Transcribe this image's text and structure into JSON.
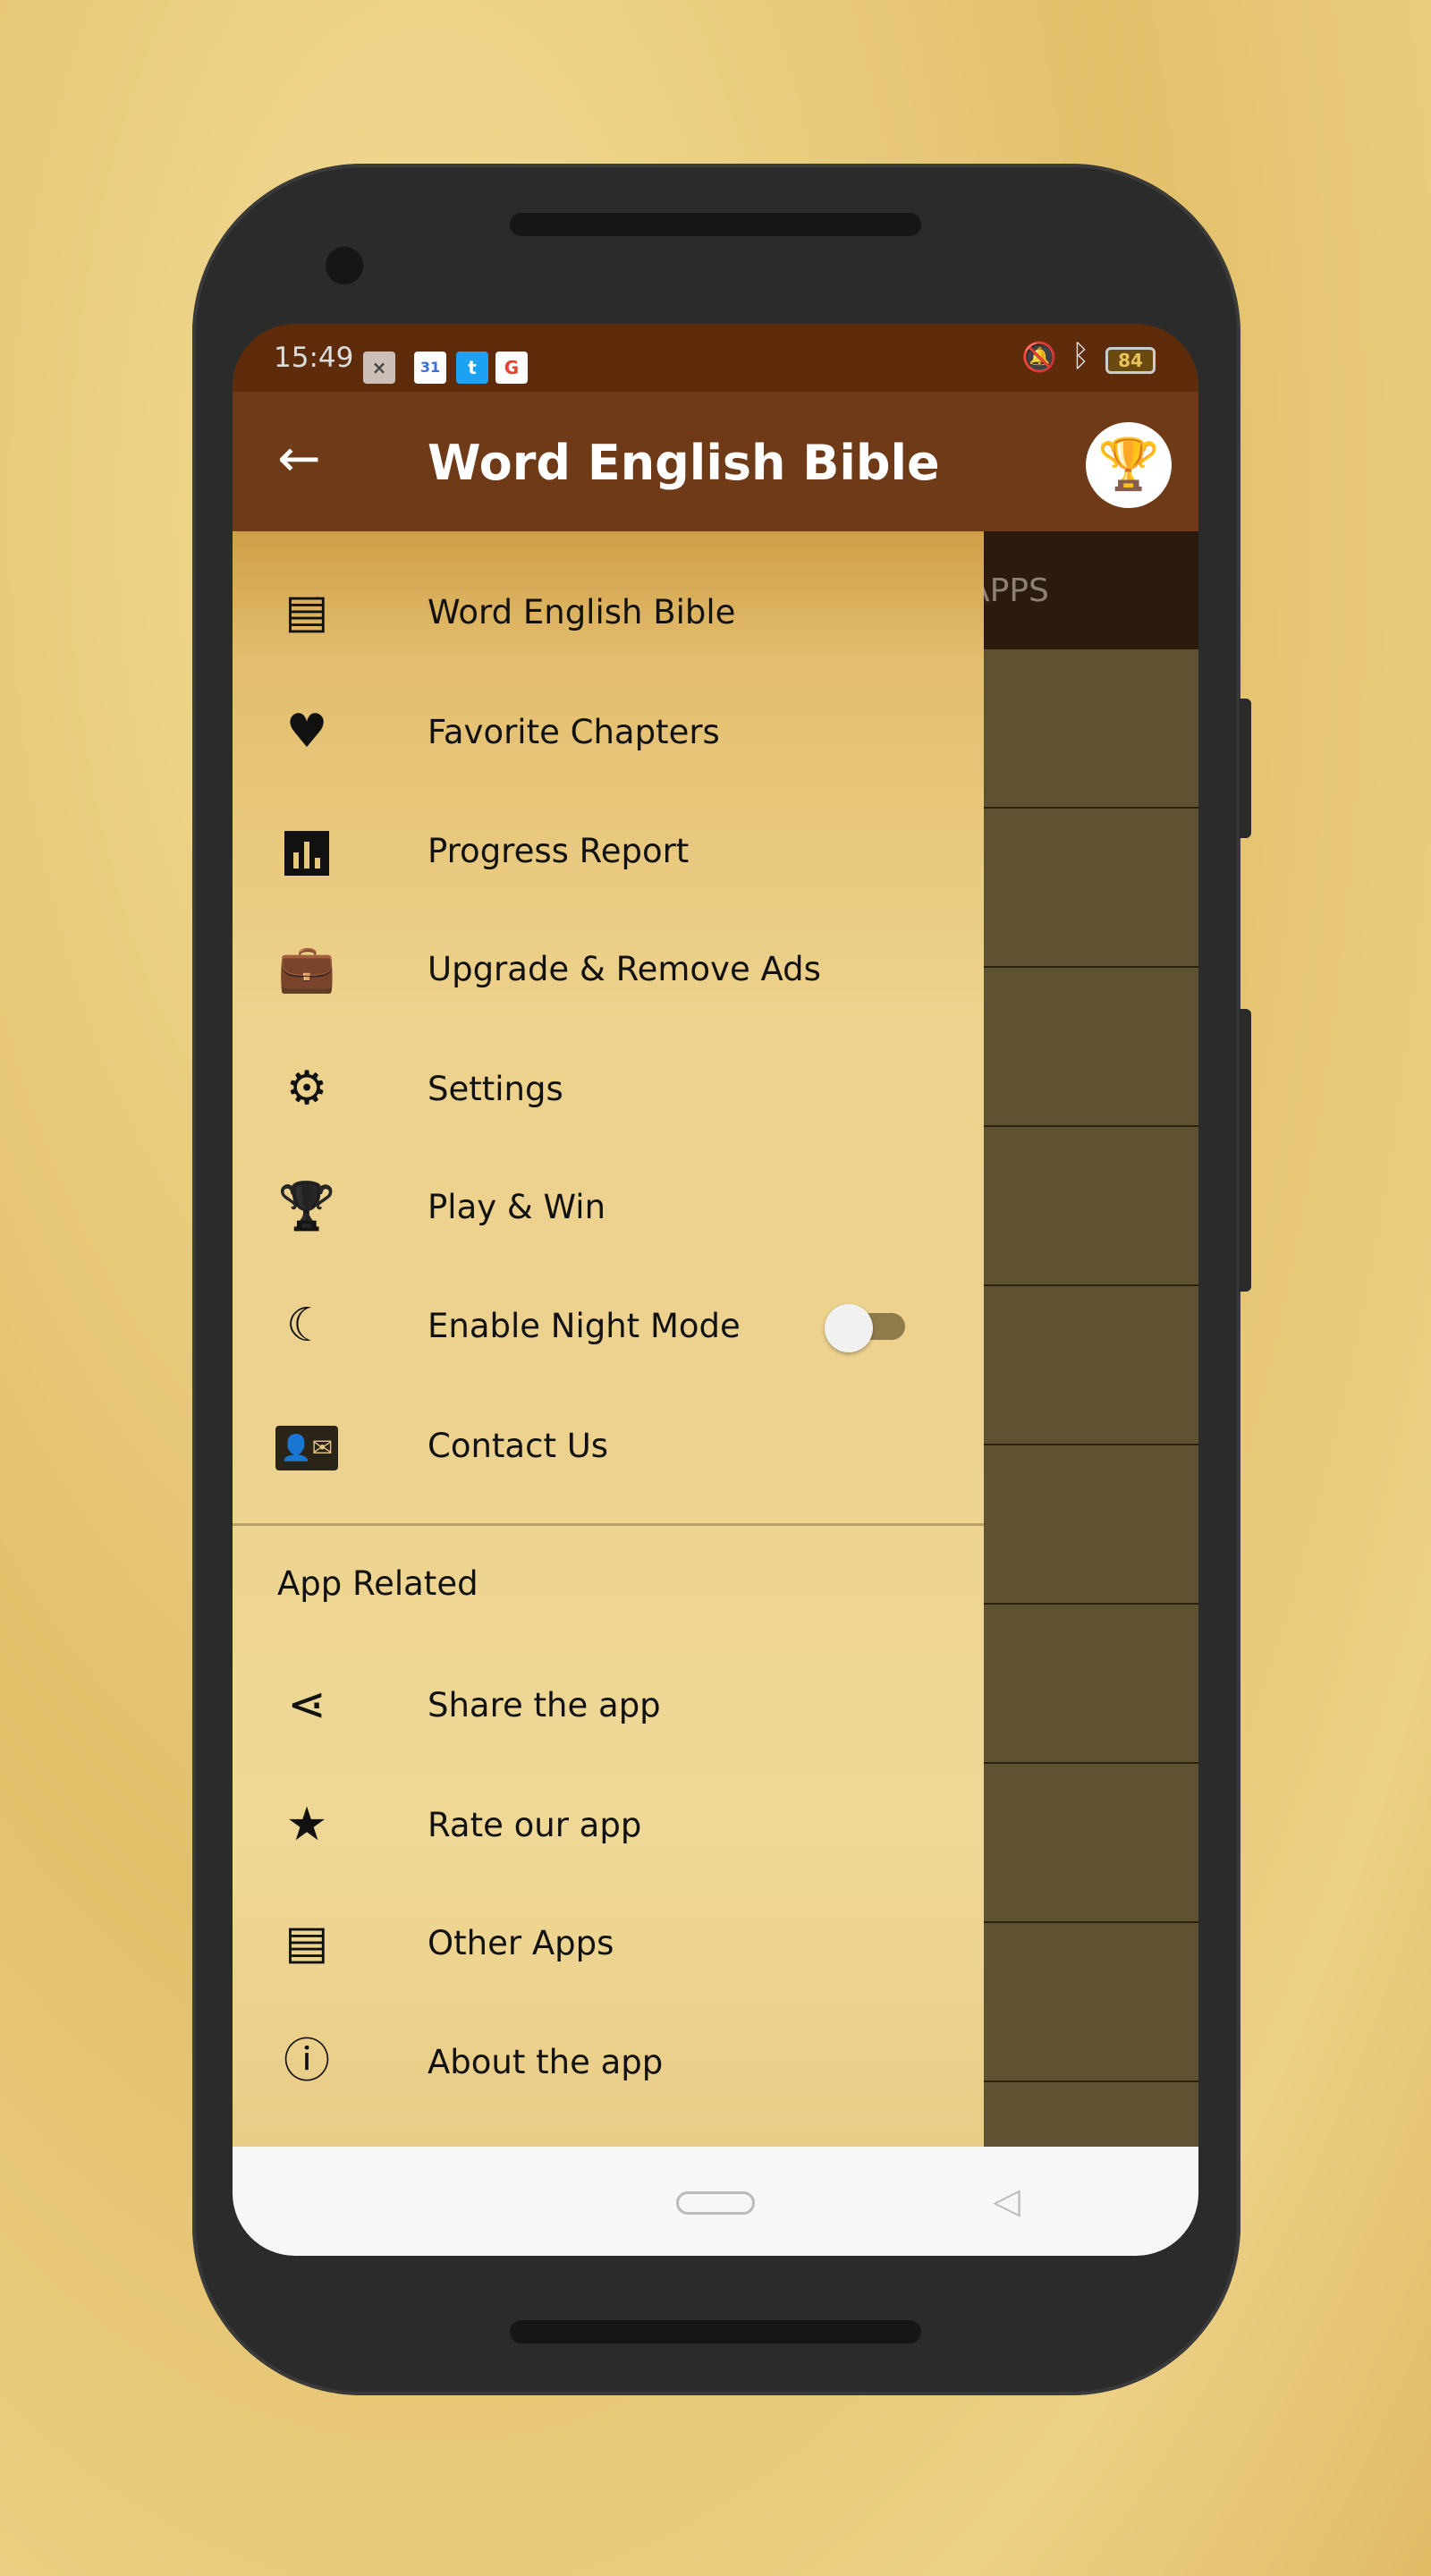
{
  "status_bar": {
    "time": "15:49",
    "battery": "84",
    "notification_icons": [
      "close-notification-icon",
      "calendar-icon",
      "twitter-icon",
      "google-icon"
    ],
    "system_icons": [
      "vibrate-icon",
      "bluetooth-icon",
      "battery-icon"
    ]
  },
  "app_bar": {
    "title": "Word English Bible",
    "back_icon": "arrow-left-icon",
    "trophy_icon": "trophy-icon"
  },
  "background_tab": {
    "label": "APPS"
  },
  "drawer": {
    "items": [
      {
        "label": "Word English Bible",
        "icon": "library-books-icon"
      },
      {
        "label": "Favorite Chapters",
        "icon": "heart-icon"
      },
      {
        "label": "Progress Report",
        "icon": "bar-chart-icon"
      },
      {
        "label": "Upgrade & Remove Ads",
        "icon": "briefcase-play-icon"
      },
      {
        "label": "Settings",
        "icon": "gear-icon"
      },
      {
        "label": "Play & Win",
        "icon": "trophy-icon"
      },
      {
        "label": "Enable Night Mode",
        "icon": "moon-icon",
        "toggle": false
      },
      {
        "label": "Contact Us",
        "icon": "contact-mail-icon"
      }
    ],
    "section_title": "App Related",
    "section_items": [
      {
        "label": "Share the app",
        "icon": "share-icon"
      },
      {
        "label": "Rate our app",
        "icon": "star-icon"
      },
      {
        "label": "Other Apps",
        "icon": "library-books-icon"
      },
      {
        "label": "About the app",
        "icon": "info-icon"
      }
    ]
  },
  "colors": {
    "status_bar": "#5e2c0a",
    "app_bar": "#6e3a17",
    "accent_toggle_track": "#8f7a4a"
  }
}
